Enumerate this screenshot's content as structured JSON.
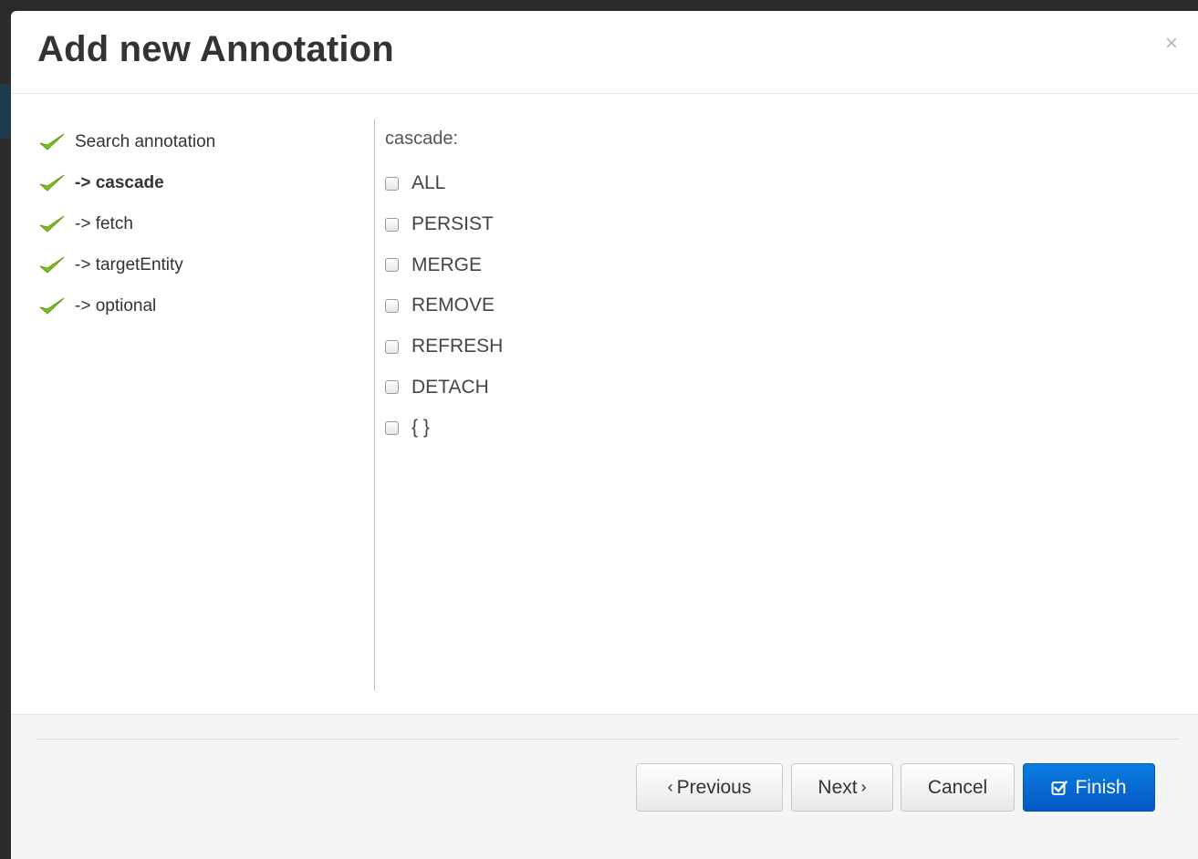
{
  "dialog": {
    "title": "Add new Annotation",
    "close_glyph": "×"
  },
  "steps": [
    {
      "label": "Search annotation",
      "icon": "check-icon",
      "active": false
    },
    {
      "label": "-> cascade",
      "icon": "check-icon",
      "active": true
    },
    {
      "label": "-> fetch",
      "icon": "check-icon",
      "active": false
    },
    {
      "label": "-> targetEntity",
      "icon": "check-icon",
      "active": false
    },
    {
      "label": "-> optional",
      "icon": "check-icon",
      "active": false
    }
  ],
  "cascade": {
    "label": "cascade:",
    "options": [
      {
        "label": "ALL",
        "checked": false
      },
      {
        "label": "PERSIST",
        "checked": false
      },
      {
        "label": "MERGE",
        "checked": false
      },
      {
        "label": "REMOVE",
        "checked": false
      },
      {
        "label": "REFRESH",
        "checked": false
      },
      {
        "label": "DETACH",
        "checked": false
      },
      {
        "label": "{ }",
        "checked": false
      }
    ]
  },
  "footer": {
    "previous_label": "Previous",
    "next_label": "Next",
    "cancel_label": "Cancel",
    "finish_label": "Finish"
  },
  "colors": {
    "check_green": "#7cc21d",
    "finish_blue": "#0a6fd6"
  }
}
